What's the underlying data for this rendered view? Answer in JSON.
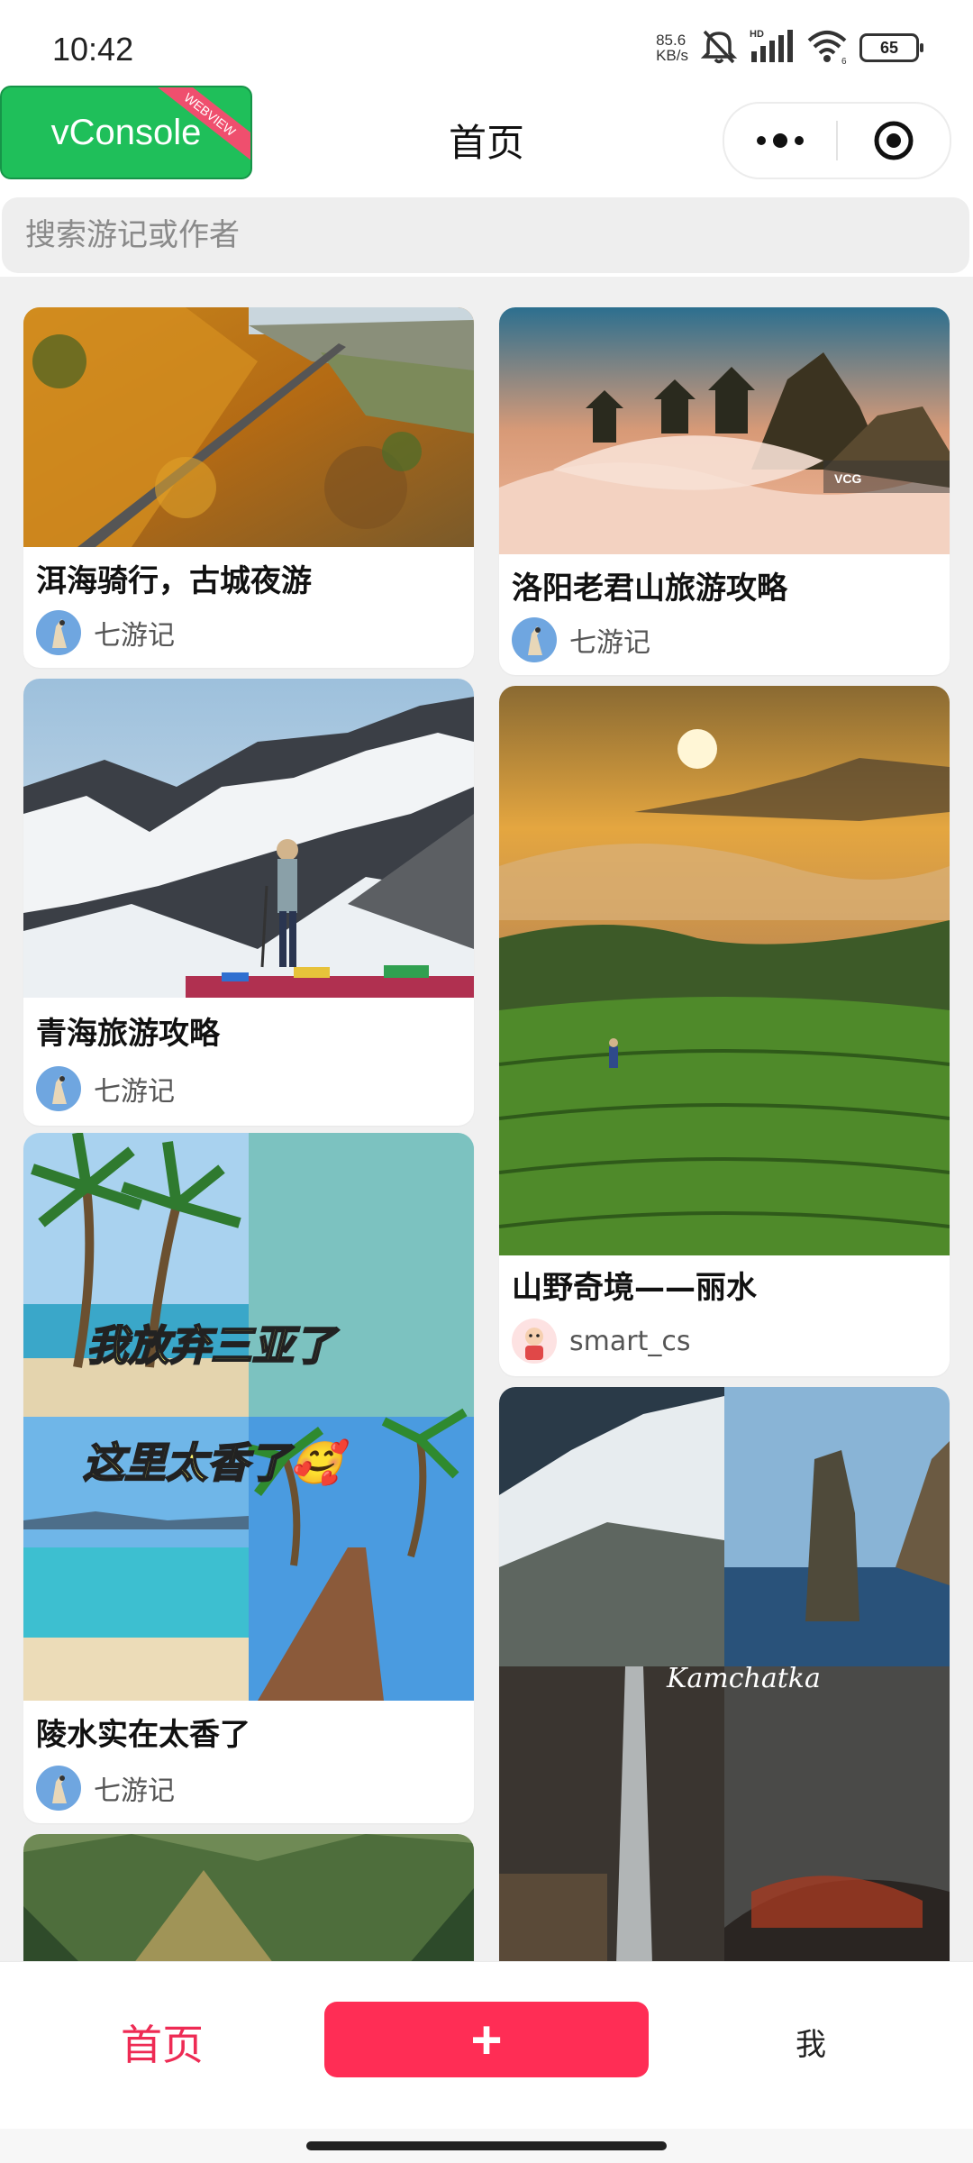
{
  "status_bar": {
    "time": "10:42",
    "net_speed_value": "85.6",
    "net_speed_unit": "KB/s",
    "signal_label": "HD",
    "wifi_label": "6",
    "battery": "65"
  },
  "header": {
    "vconsole_label": "vConsole",
    "webview_ribbon": "WEBVIEW",
    "title": "首页"
  },
  "search": {
    "placeholder": "搜索游记或作者"
  },
  "feed": {
    "left": [
      {
        "title": "洱海骑行，古城夜游",
        "author": "七游记",
        "image": "autumn-mountain-road"
      },
      {
        "title": "青海旅游攻略",
        "author": "七游记",
        "image": "snow-mountain-hiker"
      },
      {
        "title": "陵水实在太香了",
        "author": "七游记",
        "image": "sanya-beach-collage",
        "image_text_1": "我放弃三亚了",
        "image_text_2": "这里太香了🥰"
      },
      {
        "title": "",
        "author": "",
        "image": "forest-valley"
      }
    ],
    "right": [
      {
        "title": "洛阳老君山旅游攻略",
        "author": "七游记",
        "image": "laojun-mountain-sea-of-clouds",
        "watermark": "VCG"
      },
      {
        "title": "山野奇境——丽水",
        "author": "smart_cs",
        "image": "terrace-sunrise"
      },
      {
        "title": "",
        "author": "",
        "image": "kamchatka-collage",
        "image_text": "Kamchatka"
      }
    ]
  },
  "bottom_nav": {
    "home": "首页",
    "add": "+",
    "me": "我"
  },
  "colors": {
    "accent": "#ff2d55",
    "vconsole_green": "#1fbf5a"
  }
}
